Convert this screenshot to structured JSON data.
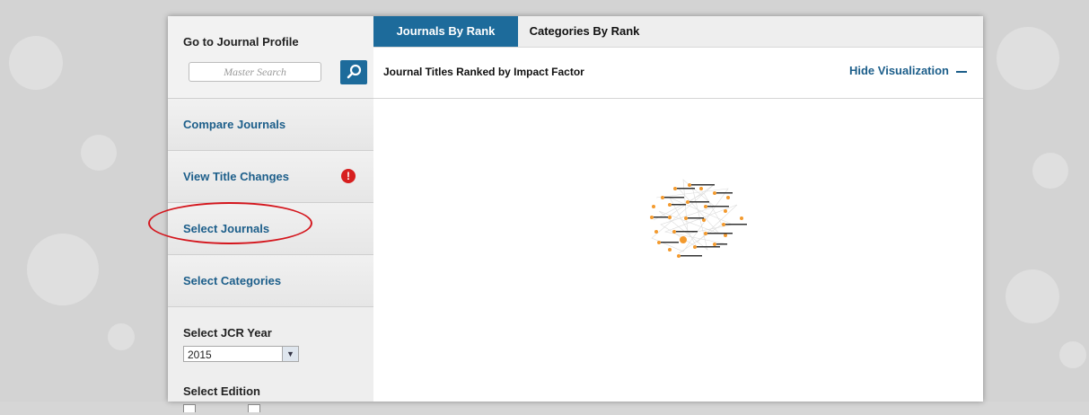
{
  "sidebar": {
    "profile_title": "Go to Journal Profile",
    "search_placeholder": "Master Search",
    "items": [
      {
        "label": "Compare Journals"
      },
      {
        "label": "View Title Changes"
      },
      {
        "label": "Select Journals"
      },
      {
        "label": "Select Categories"
      }
    ],
    "alert_glyph": "!",
    "year_label": "Select JCR Year",
    "year_value": "2015",
    "edition_label": "Select Edition"
  },
  "tabs": [
    {
      "label": "Journals By Rank",
      "active": true
    },
    {
      "label": "Categories By Rank",
      "active": false
    }
  ],
  "header": {
    "title": "Journal Titles Ranked by Impact Factor",
    "hide_label": "Hide Visualization"
  },
  "colors": {
    "accent": "#1d6b9b",
    "node": "#f39a2e",
    "alert": "#d71f1f",
    "callout": "#d4161d"
  },
  "icons": {
    "search": "search-icon",
    "alert": "exclamation-icon",
    "collapse": "minus-icon",
    "dropdown": "chevron-down-icon"
  }
}
